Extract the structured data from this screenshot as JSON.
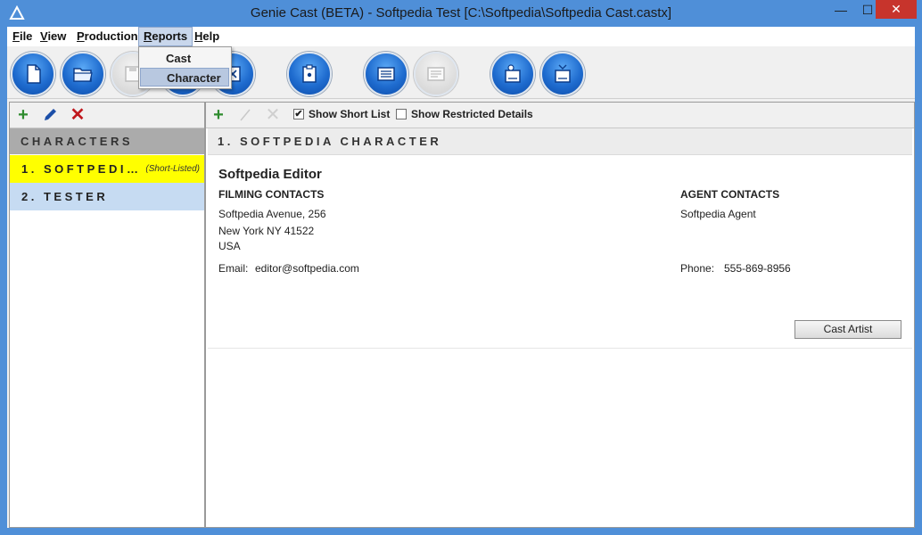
{
  "window": {
    "title": "Genie Cast (BETA) - Softpedia Test [C:\\Softpedia\\Softpedia Cast.castx]",
    "controls": {
      "minimize": "—",
      "maximize": "☐",
      "close": "✕"
    }
  },
  "menubar": {
    "items": [
      {
        "label": "File",
        "key": "F",
        "rest": "ile"
      },
      {
        "label": "View",
        "key": "V",
        "rest": "iew"
      },
      {
        "label": "Production",
        "key": "P",
        "rest": "roduction"
      },
      {
        "label": "Reports",
        "key": "R",
        "rest": "eports"
      },
      {
        "label": "Help",
        "key": "H",
        "rest": "elp"
      }
    ]
  },
  "reports_menu": {
    "items": [
      "Cast",
      "Character"
    ]
  },
  "toolbar": {
    "buttons": [
      "new-document",
      "open-folder",
      "save",
      "print",
      "close-document",
      "clipboard",
      "list-view",
      "details-view",
      "pdf-export-cast",
      "pdf-export-character"
    ]
  },
  "left_pane": {
    "header": "CHARACTERS",
    "items": [
      {
        "label": "1.  SOFTPEDI…",
        "tag": "(Short-Listed)"
      },
      {
        "label": "2.  TESTER",
        "tag": ""
      }
    ]
  },
  "right_tools": {
    "show_short_list": {
      "label": "Show Short List",
      "checked": true
    },
    "show_restricted": {
      "label": "Show Restricted Details",
      "checked": false
    }
  },
  "detail": {
    "header": "1.  SOFTPEDIA CHARACTER",
    "name": "Softpedia   Editor",
    "filming_title": "FILMING CONTACTS",
    "address1": "Softpedia Avenue, 256",
    "address2": "New York NY 41522",
    "address3": "USA",
    "email_label": "Email:",
    "email": "editor@softpedia.com",
    "agent_title": "AGENT CONTACTS",
    "agent_name": "Softpedia Agent",
    "phone_label": "Phone:",
    "phone": "555-869-8956",
    "cast_button": "Cast Artist"
  },
  "colors": {
    "titlebar": "#4f8fd8",
    "selected_row": "#ffff00",
    "alt_row": "#c6dbf2",
    "list_header": "#ababab",
    "add_icon": "#2e8b2e",
    "delete_icon": "#c0181d",
    "edit_icon": "#1c4fa8"
  }
}
